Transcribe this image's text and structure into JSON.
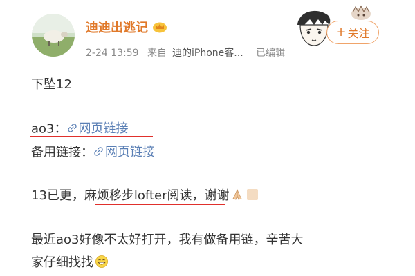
{
  "post": {
    "username": "迪迪出逃记",
    "date": "2-24 13:59",
    "source_prefix": "来自",
    "source_app": "迪的iPhone客...",
    "edited": "已编辑",
    "follow_label": "关注",
    "follow_plus": "+",
    "lines": {
      "line1": "下坠12",
      "ao3_label": "ao3：",
      "ao3_link": "网页链接",
      "backup_label": "备用链接：",
      "backup_link": "网页链接",
      "line4_prefix": "13已更，",
      "line4_highlight": "麻烦移步lofter阅读",
      "line4_suffix": "，谢谢",
      "line5a": "最近ao3好像不太好打开，我有做备用链，辛苦大",
      "line5b": "家仔细找找"
    }
  },
  "colors": {
    "username": "#e0792a",
    "link": "#5a7fb5",
    "underline": "#e0302c",
    "meta": "#8a8a8a"
  },
  "icons": [
    "avatar-sheep-photo",
    "vip-crown-icon",
    "link-chain-icon",
    "pray-hands-emoji",
    "grin-emoji",
    "anime-doodle"
  ]
}
